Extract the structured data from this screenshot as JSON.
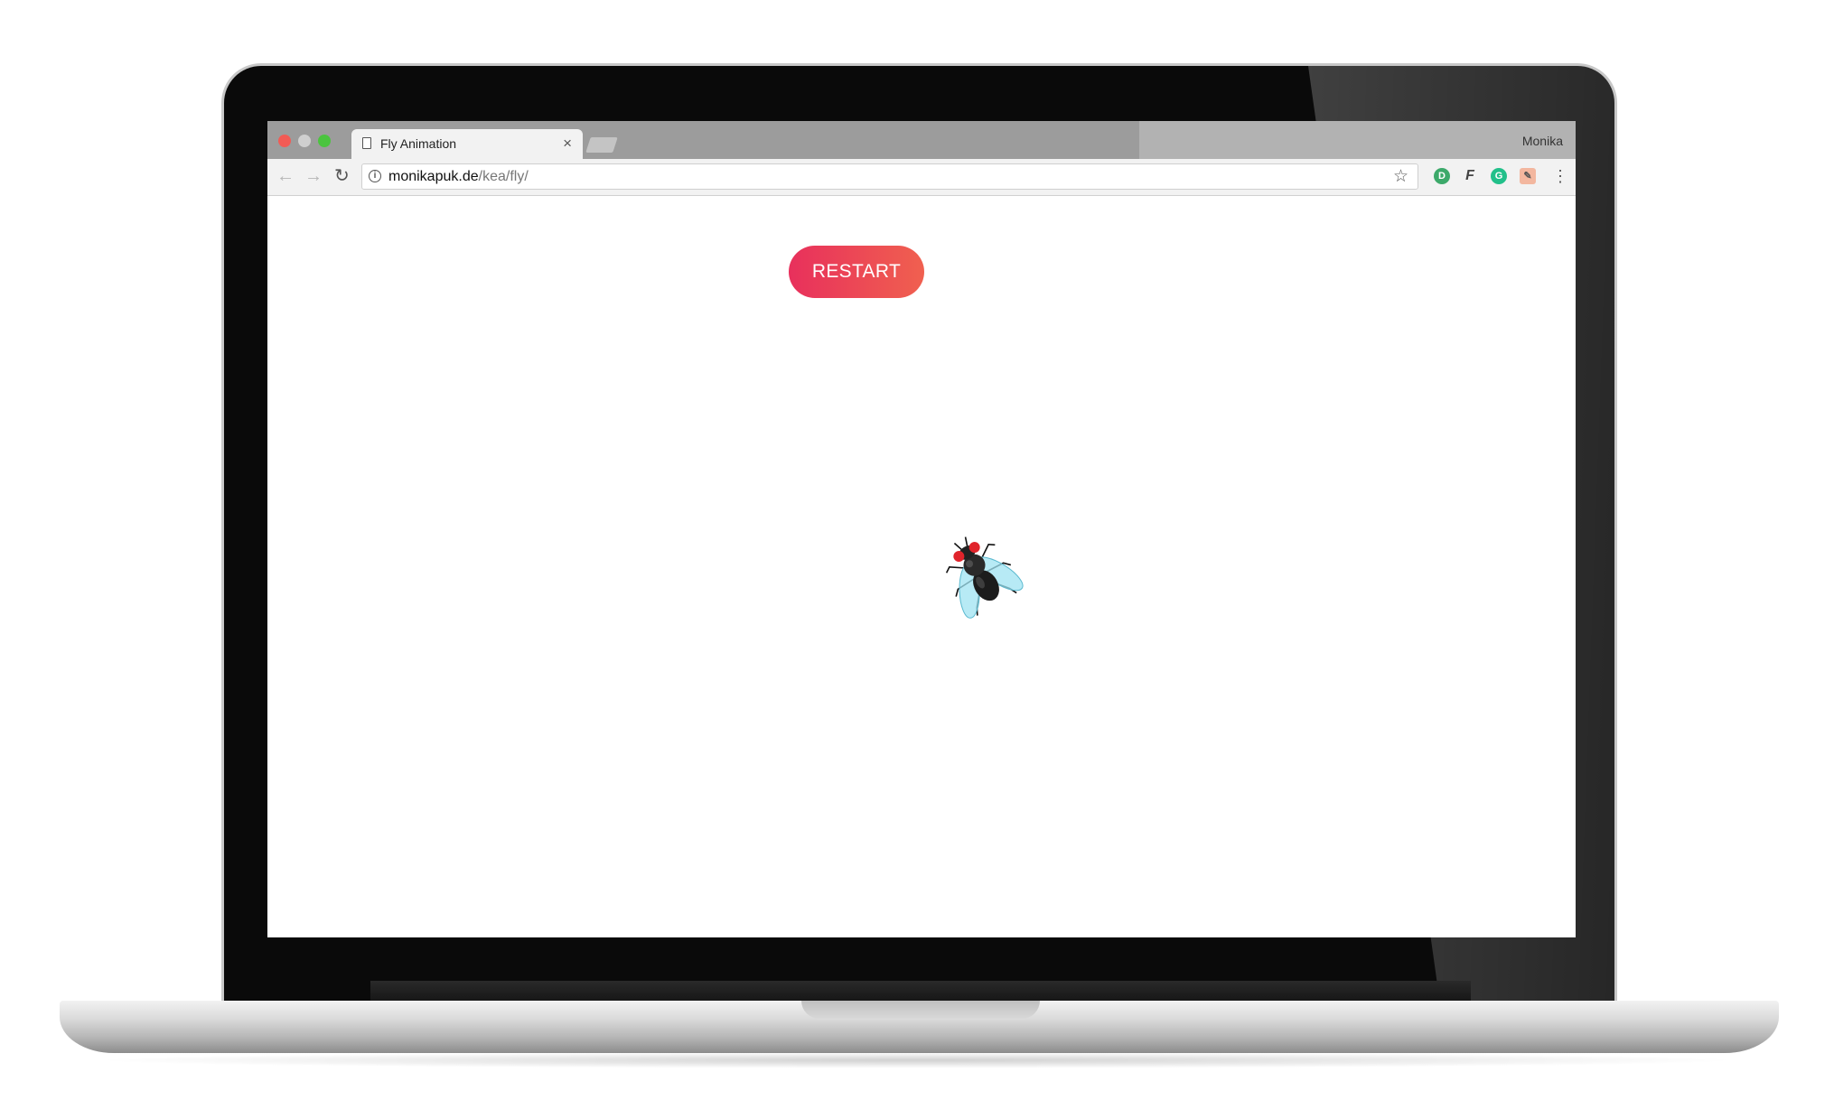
{
  "browser": {
    "tab_title": "Fly Animation",
    "tab_close": "×",
    "profile_name": "Monika",
    "url_domain": "monikapuk.de",
    "url_path": "/kea/fly/"
  },
  "page": {
    "restart_label": "RESTART"
  },
  "icons": {
    "back": "arrow-left-icon",
    "forward": "arrow-right-icon",
    "reload": "reload-icon",
    "info": "info-icon",
    "star": "star-icon",
    "menu": "more-vert-icon",
    "fly": "fly-image"
  },
  "colors": {
    "restart_start": "#e8305c",
    "restart_end": "#f0604f",
    "tabstrip": "#9c9c9c"
  }
}
